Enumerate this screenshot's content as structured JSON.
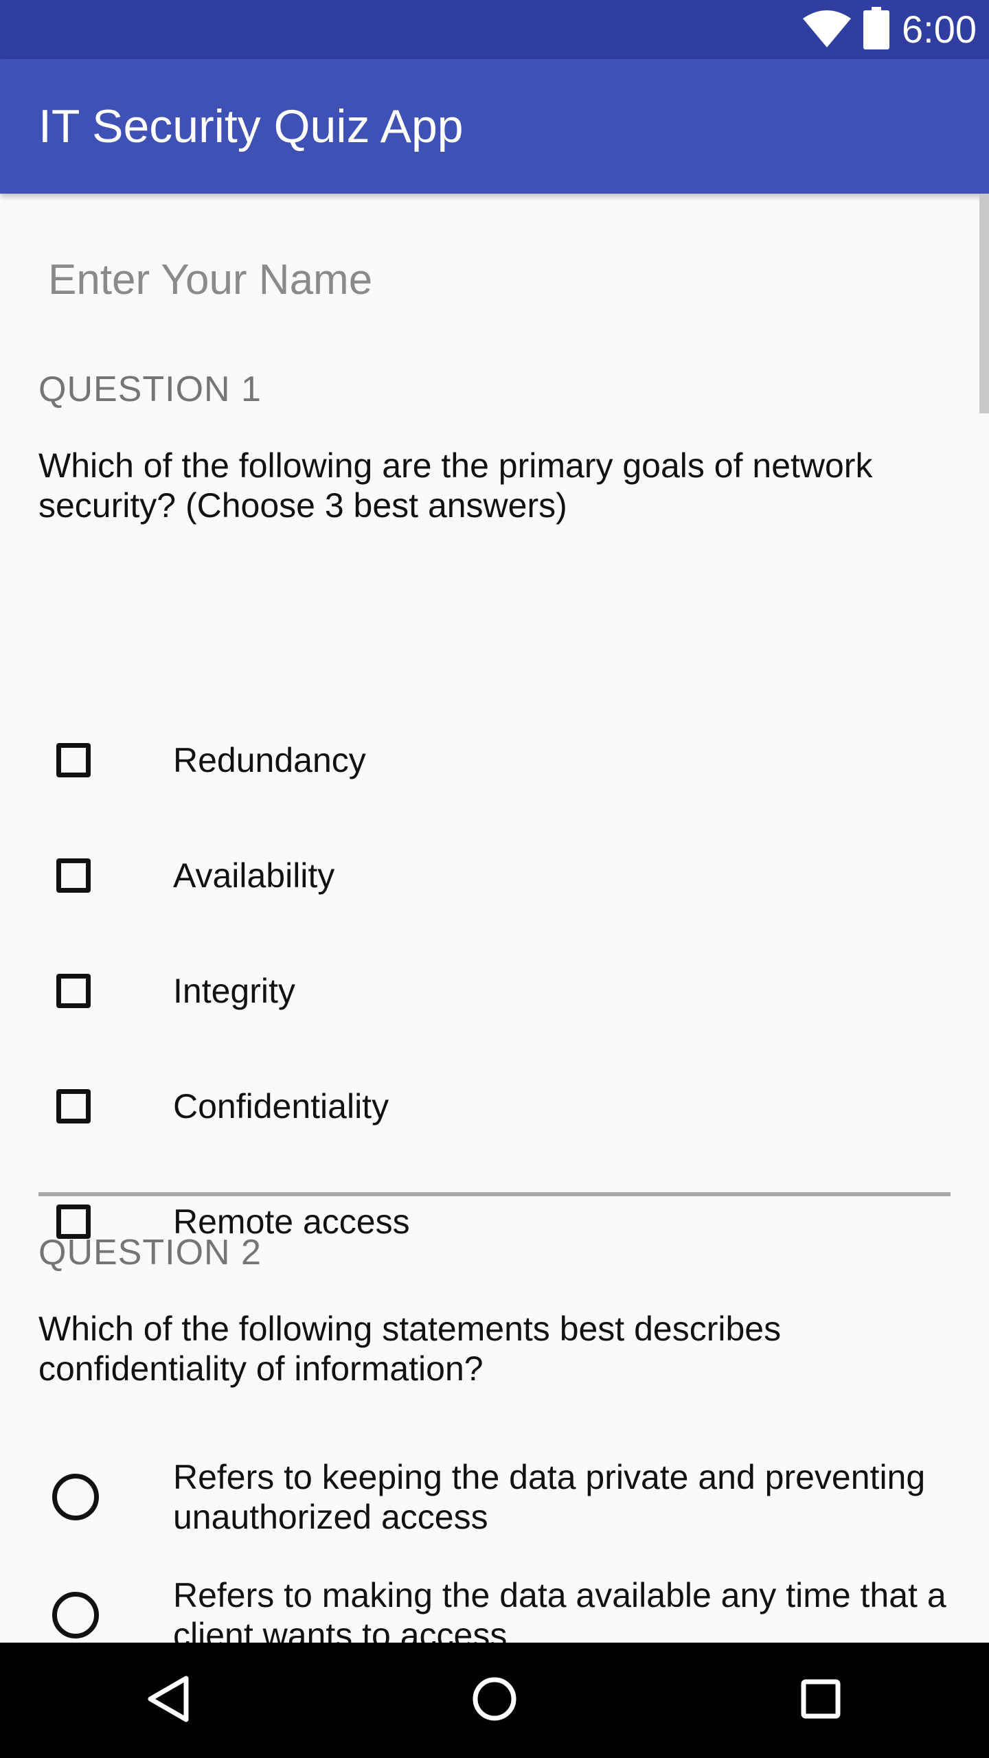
{
  "status_bar": {
    "time": "6:00",
    "icons": [
      "wifi-icon",
      "battery-icon"
    ]
  },
  "app_bar": {
    "title": "IT Security Quiz App"
  },
  "name_input": {
    "placeholder": "Enter Your Name",
    "value": ""
  },
  "questions": [
    {
      "heading": "QUESTION 1",
      "text": "Which of the following are the primary goals of network security? (Choose 3 best answers)",
      "type": "checkbox",
      "options": [
        {
          "label": "Redundancy",
          "checked": false
        },
        {
          "label": "Availability",
          "checked": false
        },
        {
          "label": "Integrity",
          "checked": false
        },
        {
          "label": "Confidentiality",
          "checked": false
        },
        {
          "label": "Remote access",
          "checked": false
        }
      ]
    },
    {
      "heading": "QUESTION 2",
      "text": "Which of the following statements best describes confidentiality of information?",
      "type": "radio",
      "options": [
        {
          "label": "Refers to keeping the data private and preventing unauthorized access",
          "checked": false
        },
        {
          "label": "Refers to making the data available any time that a client wants to access",
          "checked": false
        }
      ]
    }
  ],
  "nav_bar": {
    "icons": [
      "back-icon",
      "home-icon",
      "recents-icon"
    ]
  },
  "colors": {
    "status_bar": "#303f9f",
    "app_bar": "#3f51b5",
    "background": "#fafafa"
  }
}
